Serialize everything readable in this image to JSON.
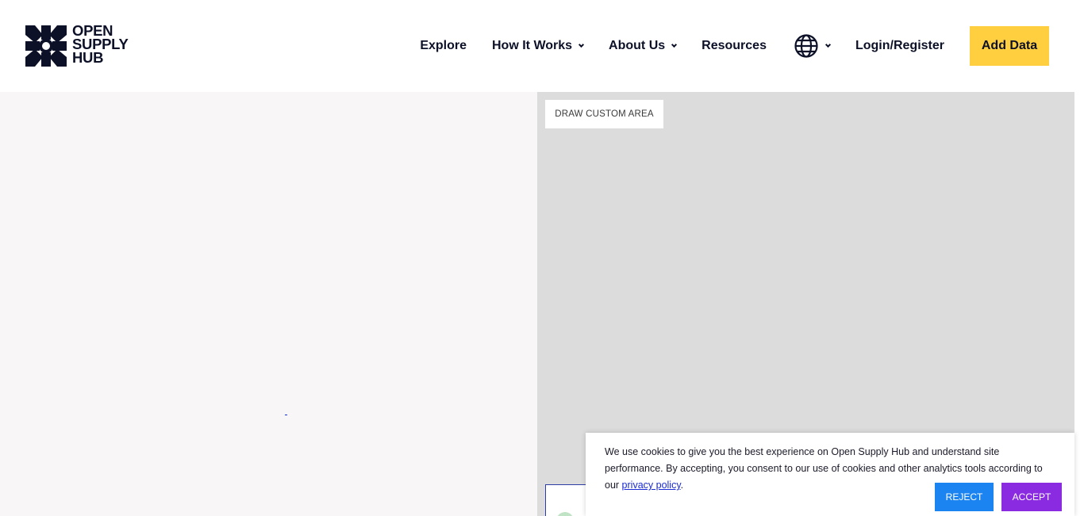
{
  "brand": {
    "logo_lines": [
      "OPEN",
      "SUPPLY",
      "HUB"
    ],
    "logo_icon": "open-supply-hub-logo-icon"
  },
  "nav": {
    "explore": "Explore",
    "how_it_works": "How It Works",
    "about_us": "About Us",
    "resources": "Resources",
    "language_icon": "globe-icon",
    "login": "Login/Register",
    "add_data": "Add Data"
  },
  "map": {
    "draw_custom_area": "DRAW CUSTOM AREA"
  },
  "cookie_banner": {
    "text": "We use cookies to give you the best experience on Open Supply Hub and understand site performance. By accepting, you consent to our use of cookies and other analytics tools according to our ",
    "link": "privacy policy",
    "text_end": ".",
    "reject": "REJECT",
    "accept": "ACCEPT"
  },
  "colors": {
    "navy": "#0d1128",
    "add_data_yellow": "#ffcf3f",
    "left_pane_bg": "#f8f6f7",
    "map_bg": "#dcdcdc",
    "reject_blue": "#1b84f0",
    "accept_purple": "#8a2be2",
    "link_blue": "#1a2bd6"
  }
}
